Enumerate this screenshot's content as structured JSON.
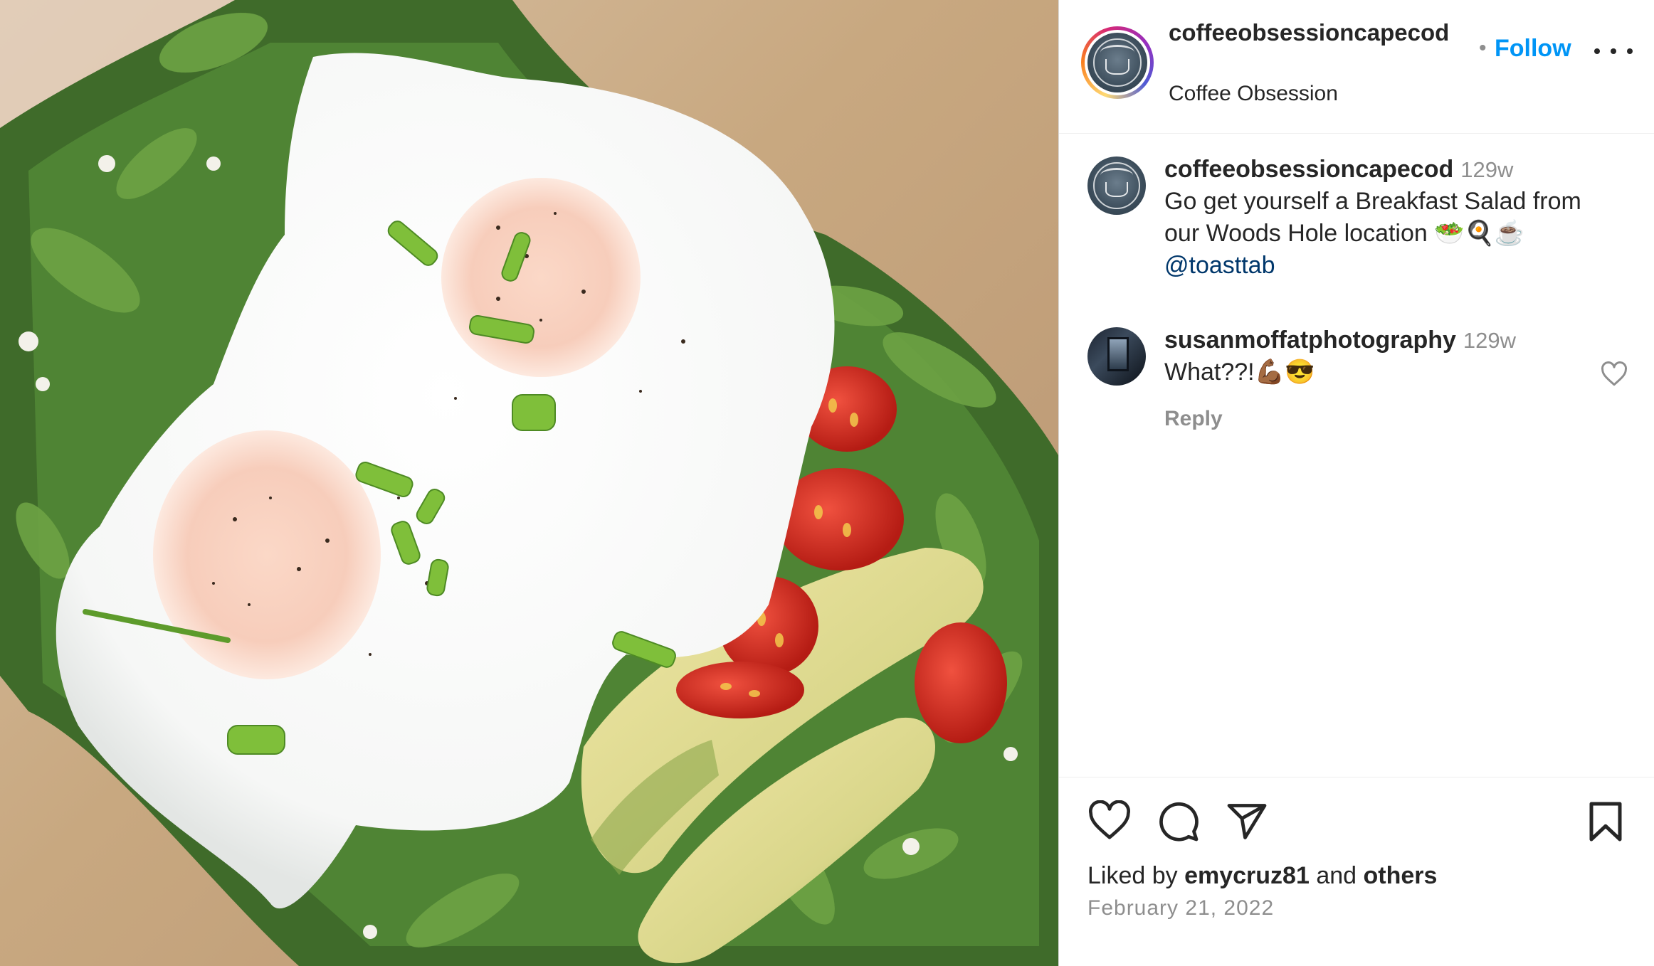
{
  "post": {
    "image_alt": "Breakfast salad with two fried eggs, arugula, cherry tomatoes and avocado",
    "header": {
      "username": "coffeeobsessioncapecod",
      "subtitle": "Coffee Obsession",
      "dot": "•",
      "follow_label": "Follow"
    },
    "caption": {
      "username": "coffeeobsessioncapecod",
      "time": "129w",
      "text": "Go get yourself a Breakfast Salad from our Woods Hole location 🥗🍳☕",
      "mention": "@toasttab"
    },
    "comments": [
      {
        "username": "susanmoffatphotography",
        "time": "129w",
        "text": "What??!💪🏾😎",
        "reply_label": "Reply"
      }
    ],
    "footer": {
      "liked_prefix": "Liked by",
      "liked_user": "emycruz81",
      "liked_and": "and",
      "liked_others": "others",
      "date": "February 21, 2022"
    }
  },
  "icons": {
    "more": "more-horizontal-icon",
    "like": "heart-icon",
    "comment": "comment-bubble-icon",
    "share": "paper-plane-icon",
    "save": "bookmark-icon"
  },
  "colors": {
    "follow": "#0095f6",
    "text": "#262626",
    "secondary": "#8e8e8e",
    "mention": "#00376b"
  }
}
